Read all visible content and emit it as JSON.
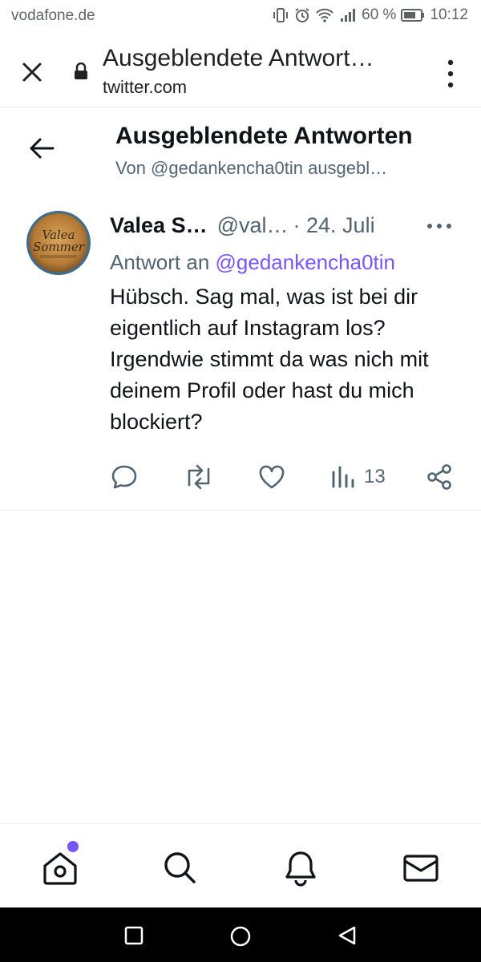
{
  "status_bar": {
    "carrier": "vodafone.de",
    "battery_percent": "60 %",
    "time": "10:12"
  },
  "browser": {
    "page_title": "Ausgeblendete Antwort…",
    "host": "twitter.com"
  },
  "header": {
    "title": "Ausgeblendete Antworten",
    "subtitle": "Von @gedankencha0tin ausgebl…"
  },
  "tweet": {
    "author_name": "Valea S…",
    "author_handle": "@val…",
    "date": "· 24. Juli",
    "reply_prefix": "Antwort an",
    "reply_to": "@gedankencha0tin",
    "text": "Hübsch. Sag mal, was ist bei dir eigentlich auf Instagram los? Irgendwie stimmt da was nich mit deinem Profil oder hast du mich blockiert?",
    "views_count": "13",
    "avatar_text": "Valea Sommer"
  },
  "colors": {
    "accent": "#7856ff",
    "secondary_text": "#536471",
    "primary_text": "#0f1419"
  },
  "icons": {
    "bottom_nav": [
      "home-icon",
      "search-icon",
      "notifications-icon",
      "messages-icon"
    ],
    "actions": [
      "reply-icon",
      "retweet-icon",
      "like-icon",
      "views-icon",
      "share-icon"
    ]
  }
}
